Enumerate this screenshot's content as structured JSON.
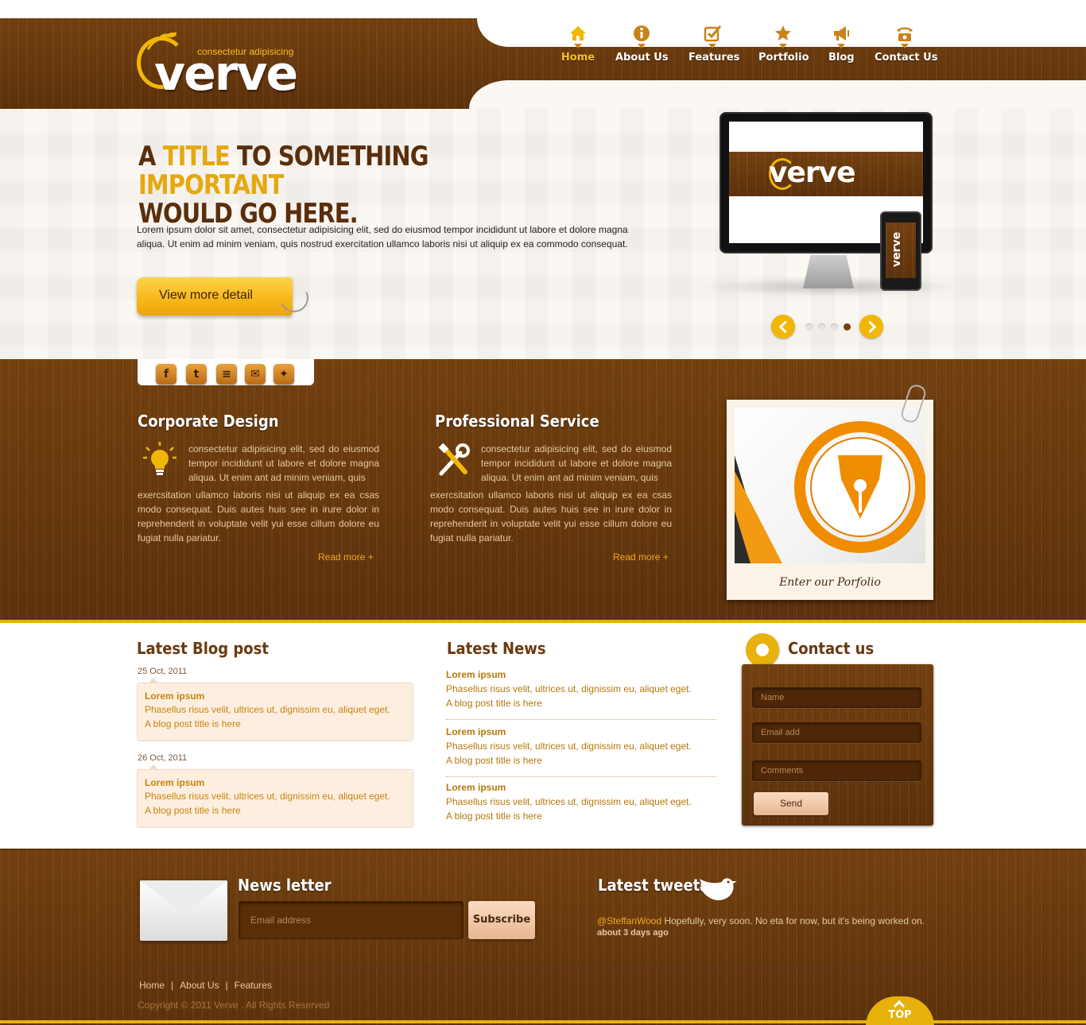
{
  "brand": {
    "name": "verve",
    "tagline": "consectetur adipisicing",
    "accent_color": "#f2b705",
    "wood_color": "#6b3a10"
  },
  "nav": {
    "items": [
      {
        "label": "Home",
        "icon": "home-icon",
        "active": true
      },
      {
        "label": "About Us",
        "icon": "info-icon"
      },
      {
        "label": "Features",
        "icon": "checkbox-icon"
      },
      {
        "label": "Portfolio",
        "icon": "star-icon"
      },
      {
        "label": "Blog",
        "icon": "megaphone-icon"
      },
      {
        "label": "Contact Us",
        "icon": "phone-icon"
      }
    ]
  },
  "hero": {
    "title_a": "A ",
    "title_b": "TITLE",
    "title_c": " TO SOMETHING ",
    "title_d": "IMPORTANT",
    "title_e": "WOULD GO HERE.",
    "text": "Lorem ipsum dolor sit amet, consectetur adipisicing elit, sed do eiusmod tempor incididunt ut labore et dolore magna aliqua. Ut enim ad minim veniam, quis nostrud exercitation ullamco laboris nisi ut aliquip ex ea commodo consequat.",
    "button_label": "View more detail",
    "screen_logo": "verve",
    "slider": {
      "total": 4,
      "active": 4
    }
  },
  "social": {
    "items": [
      {
        "glyph": "f",
        "icon": "facebook-icon"
      },
      {
        "glyph": "t",
        "icon": "twitter-icon"
      },
      {
        "glyph": "≡",
        "icon": "rss-icon"
      },
      {
        "glyph": "✉",
        "icon": "email-icon"
      },
      {
        "glyph": "✦",
        "icon": "myspace-icon"
      }
    ]
  },
  "features": {
    "corporate": {
      "title": "Corporate Design",
      "icon": "lightbulb-icon",
      "intro": "consectetur adipisicing elit, sed do eiusmod tempor incididunt ut labore et dolore magna aliqua. Ut enim ant ad minim veniam, quis",
      "body": "exercsitation ullamco laboris nisi ut aliquip ex ea csas modo consequat. Duis autes huis see in  irure dolor in reprehenderit in voluptate velit yui esse cillum dolore eu fugiat nulla pariatur.",
      "read_more": "Read more +"
    },
    "professional": {
      "title": "Professional Service",
      "icon": "tools-icon",
      "intro": "consectetur adipisicing elit, sed do eiusmod tempor incididunt ut labore et dolore magna aliqua. Ut enim ant ad minim veniam, quis",
      "body": "exercsitation ullamco laboris nisi ut aliquip ex ea csas modo consequat. Duis autes huis see in  irure dolor in reprehenderit in voluptate velit yui esse cillum dolore eu fugiat nulla pariatur.",
      "read_more": "Read more +"
    },
    "portfolio_caption": "Enter our Porfolio"
  },
  "blog": {
    "title": "Latest Blog post",
    "posts": [
      {
        "date": "25 Oct, 2011",
        "title": "Lorem ipsum",
        "text": "Phasellus risus velit, ultrices ut, dignissim eu, aliquet eget.",
        "link": "A blog post title is here"
      },
      {
        "date": "26 Oct, 2011",
        "title": "Lorem ipsum",
        "text": "Phasellus risus velit, ultrices ut, dignissim eu, aliquet eget.",
        "link": "A blog post title is here"
      }
    ]
  },
  "news": {
    "title": "Latest News",
    "items": [
      {
        "title": "Lorem ipsum",
        "text": "Phasellus risus velit, ultrices ut, dignissim eu, aliquet eget.",
        "link": "A blog post title is here"
      },
      {
        "title": "Lorem ipsum",
        "text": "Phasellus risus velit, ultrices ut, dignissim eu, aliquet eget.",
        "link": "A blog post title is here"
      },
      {
        "title": "Lorem ipsum",
        "text": "Phasellus risus velit, ultrices ut, dignissim eu, aliquet eget.",
        "link": "A blog post title is here"
      }
    ]
  },
  "contact": {
    "title": "Contact us",
    "name_placeholder": "Name",
    "email_placeholder": "Email add",
    "comments_placeholder": "Comments",
    "send_label": "Send"
  },
  "footer": {
    "newsletter_title": "News letter",
    "newsletter_placeholder": "Email address",
    "subscribe_label": "Subscribe",
    "tweets_title": "Latest tweets",
    "tweet_user": "@SteffanWood",
    "tweet_text": " Hopefully, very soon. No eta for now, but it's being worked on.",
    "tweet_time": "about 3 days ago",
    "links": [
      "Home",
      "About Us",
      "Features"
    ],
    "pipe": "|",
    "copyright": "Copyright © 2011 Verve . All Rights Reserved",
    "top_label": "TOP"
  }
}
